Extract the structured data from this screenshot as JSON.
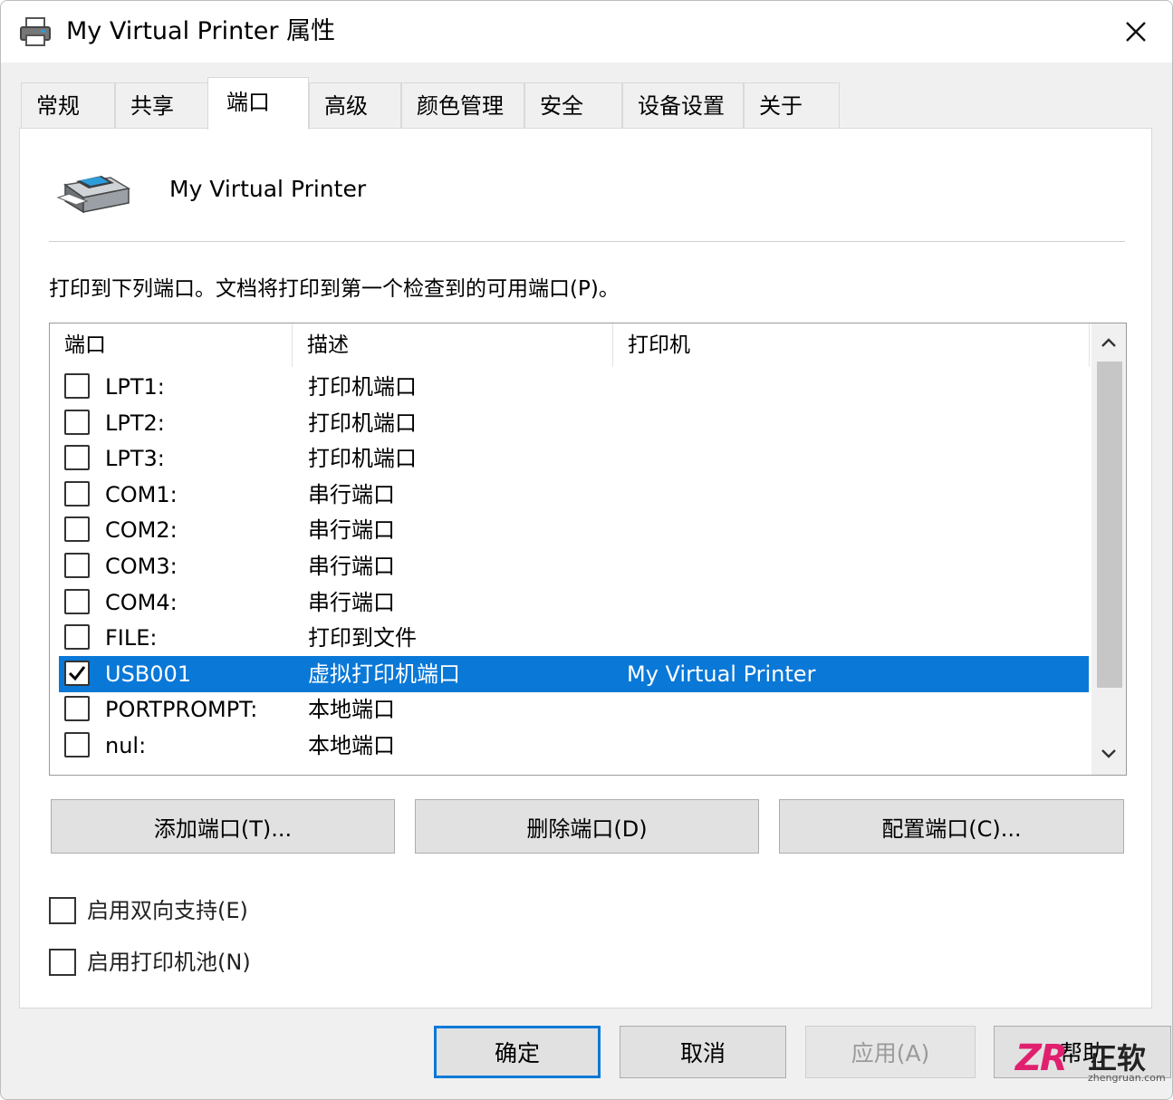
{
  "window": {
    "title": "My Virtual Printer 属性",
    "close_icon": "close-icon"
  },
  "tabs": [
    {
      "label": "常规"
    },
    {
      "label": "共享"
    },
    {
      "label": "端口",
      "active": true
    },
    {
      "label": "高级"
    },
    {
      "label": "颜色管理"
    },
    {
      "label": "安全"
    },
    {
      "label": "设备设置"
    },
    {
      "label": "关于"
    }
  ],
  "printer": {
    "name": "My Virtual Printer",
    "icon": "printer-icon"
  },
  "instruction": "打印到下列端口。文档将打印到第一个检查到的可用端口(P)。",
  "port_list": {
    "columns": [
      "端口",
      "描述",
      "打印机"
    ],
    "rows": [
      {
        "port": "LPT1:",
        "desc": "打印机端口",
        "printer": "",
        "checked": false,
        "selected": false
      },
      {
        "port": "LPT2:",
        "desc": "打印机端口",
        "printer": "",
        "checked": false,
        "selected": false
      },
      {
        "port": "LPT3:",
        "desc": "打印机端口",
        "printer": "",
        "checked": false,
        "selected": false
      },
      {
        "port": "COM1:",
        "desc": "串行端口",
        "printer": "",
        "checked": false,
        "selected": false
      },
      {
        "port": "COM2:",
        "desc": "串行端口",
        "printer": "",
        "checked": false,
        "selected": false
      },
      {
        "port": "COM3:",
        "desc": "串行端口",
        "printer": "",
        "checked": false,
        "selected": false
      },
      {
        "port": "COM4:",
        "desc": "串行端口",
        "printer": "",
        "checked": false,
        "selected": false
      },
      {
        "port": "FILE:",
        "desc": "打印到文件",
        "printer": "",
        "checked": false,
        "selected": false
      },
      {
        "port": "USB001",
        "desc": "虚拟打印机端口",
        "printer": "My Virtual Printer",
        "checked": true,
        "selected": true
      },
      {
        "port": "PORTPROMPT:",
        "desc": "本地端口",
        "printer": "",
        "checked": false,
        "selected": false
      },
      {
        "port": "nul:",
        "desc": "本地端口",
        "printer": "",
        "checked": false,
        "selected": false
      }
    ]
  },
  "port_buttons": {
    "add": "添加端口(T)...",
    "delete": "删除端口(D)",
    "configure": "配置端口(C)..."
  },
  "options": {
    "bidirectional": "启用双向支持(E)",
    "pooling": "启用打印机池(N)"
  },
  "footer": {
    "ok": "确定",
    "cancel": "取消",
    "apply": "应用(A)",
    "help": "帮助"
  },
  "watermark": {
    "logo": "ZR",
    "name": "正软",
    "url": "zhengruan.com"
  },
  "colors": {
    "selection": "#0a78d7",
    "background": "#f0f0f0"
  }
}
